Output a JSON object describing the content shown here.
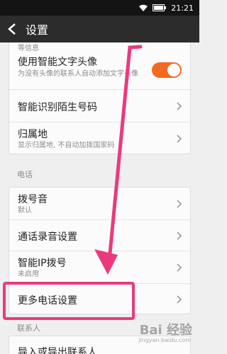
{
  "status_bar": {
    "time": "21:21"
  },
  "app_bar": {
    "title": "设置"
  },
  "top_partial": {
    "text": "等信息"
  },
  "rows_top": [
    {
      "title": "使用智能文字头像",
      "subtitle": "为没有头像的联系人自动添加文字头像"
    },
    {
      "title": "智能识别陌生号码"
    },
    {
      "title": "归属地",
      "subtitle": "显示归属地, 不自动加拨国家码"
    }
  ],
  "section_phone": {
    "header": "电话"
  },
  "rows_phone": [
    {
      "title": "拨号音",
      "subtitle": "默认"
    },
    {
      "title": "通话录音设置"
    },
    {
      "title": "智能IP拨号",
      "subtitle": "未启用"
    },
    {
      "title": "更多电话设置"
    }
  ],
  "section_contacts": {
    "header": "联系人"
  },
  "rows_contacts": [
    {
      "title": "导入或导出联系人"
    }
  ],
  "toggle": {
    "state": "on"
  },
  "colors": {
    "accent": "#f26a20",
    "highlight": "#ea3a7d"
  },
  "watermark": {
    "text": "Bai  经验",
    "sub": "jingyan.baidu.com"
  }
}
